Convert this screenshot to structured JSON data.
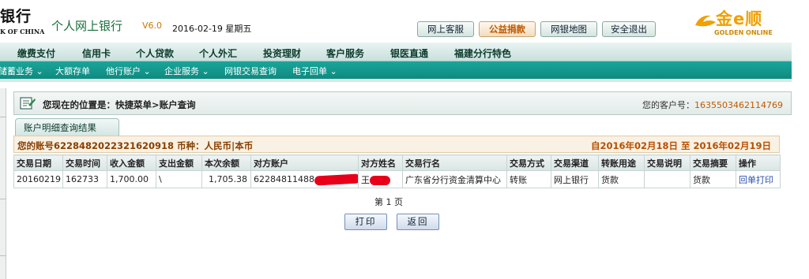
{
  "header": {
    "bank_name": "银行",
    "bank_en": "K OF CHINA",
    "app_title": "个人网上银行",
    "version": "V6.0",
    "date": "2016-02-19 星期五",
    "top_buttons": [
      "网上客服",
      "公益捐款",
      "网银地图",
      "安全退出"
    ],
    "logo_cn": "金e顺",
    "logo_en": "GOLDEN ONLINE"
  },
  "nav_primary": [
    "缴费支付",
    "信用卡",
    "个人贷款",
    "个人外汇",
    "投资理财",
    "客户服务",
    "银医直通",
    "福建分行特色"
  ],
  "nav_secondary": [
    "储蓄业务",
    "大额存单",
    "他行账户",
    "企业服务",
    "网银交易查询",
    "电子回单"
  ],
  "location": {
    "label": "您现在的位置是：快捷菜单>账户查询",
    "customer_label": "您的客户号：",
    "customer_no": "1635503462114769"
  },
  "tab_title": "账户明细查询结果",
  "summary": {
    "account": "您的账号6228482022321620918 币种：人民币|本币",
    "range": "自2016年02月18日 至 2016年02月19日"
  },
  "table": {
    "headers": [
      "交易日期",
      "交易时间",
      "收入金额",
      "支出金额",
      "本次余额",
      "对方账户",
      "对方姓名",
      "交易行名",
      "交易方式",
      "交易渠道",
      "转账用途",
      "交易说明",
      "交易摘要",
      "操作"
    ],
    "row": {
      "date": "20160219",
      "time": "162733",
      "income": "1,700.00",
      "expense": "\\",
      "balance": "1,705.38",
      "counter_account": "62284811488",
      "counter_name": "王",
      "bank_name": "广东省分行资金清算中心",
      "method": "转账",
      "channel": "网上银行",
      "purpose": "货款",
      "note": "",
      "summary": "货款",
      "action": "回单打印"
    }
  },
  "pager": "第 1 页",
  "buttons": {
    "print": "打印",
    "back": "返回"
  },
  "colors": {
    "teal": "#0f8a80",
    "orange": "#c05a00",
    "link": "#2a4fb0"
  }
}
